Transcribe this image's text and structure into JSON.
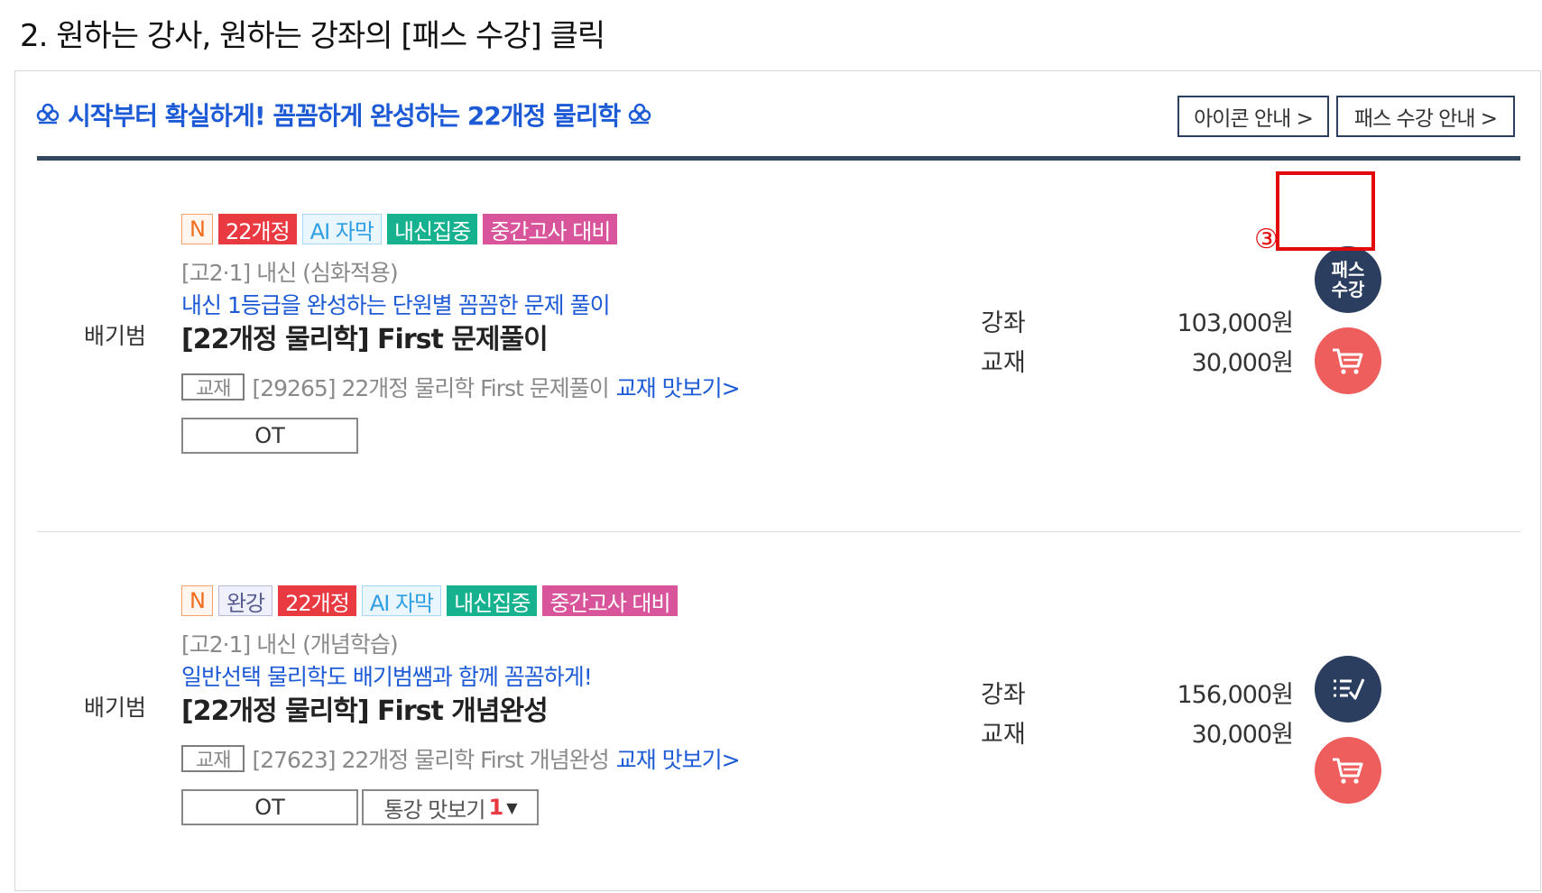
{
  "step_heading": "2. 원하는 강사, 원하는 강좌의 [패스 수강] 클릭",
  "section": {
    "title": "시작부터 확실하게! 꼼꼼하게 완성하는 22개정 물리학",
    "icon_guide_label": "아이콘 안내 >",
    "pass_guide_label": "패스 수강 안내 >"
  },
  "courses": [
    {
      "tags": {
        "new": "N",
        "curriculum": "22개정",
        "ai": "AI 자막",
        "school": "내신집중",
        "midterm": "중간고사 대비"
      },
      "level": "[고2·1] 내신 (심화적용)",
      "tagline": "내신 1등급을 완성하는 단원별 꼼꼼한 문제 풀이",
      "teacher": "배기범",
      "title": "[22개정 물리학] First 문제풀이",
      "book_label": "교재",
      "book_name": "[29265] 22개정 물리학 First 문제풀이",
      "book_preview": "교재 맛보기>",
      "ot_label": "OT",
      "lecture_label": "강좌",
      "book_price_label": "교재",
      "lecture_price": "103,000원",
      "book_price": "30,000원",
      "pass_label_line1": "패스",
      "pass_label_line2": "수강"
    },
    {
      "tags": {
        "new": "N",
        "complete": "완강",
        "curriculum": "22개정",
        "ai": "AI 자막",
        "school": "내신집중",
        "midterm": "중간고사 대비"
      },
      "level": "[고2·1] 내신 (개념학습)",
      "tagline": "일반선택 물리학도 배기범쌤과 함께 꼼꼼하게!",
      "teacher": "배기범",
      "title": "[22개정 물리학] First 개념완성",
      "book_label": "교재",
      "book_name": "[27623] 22개정 물리학 First 개념완성",
      "book_preview": "교재 맛보기>",
      "ot_label": "OT",
      "sample_label": "통강 맛보기",
      "sample_count": "1",
      "lecture_label": "강좌",
      "book_price_label": "교재",
      "lecture_price": "156,000원",
      "book_price": "30,000원"
    }
  ],
  "annotation": {
    "step_marker": "③",
    "color": "#e20a0a"
  },
  "icons": [
    "clover-icon",
    "cart-icon",
    "checklist-icon",
    "dropdown-arrow-icon"
  ],
  "colors": {
    "navy": "#2b3e5f",
    "blue_text": "#1c5ad6",
    "cart_red": "#ee5e5d"
  }
}
